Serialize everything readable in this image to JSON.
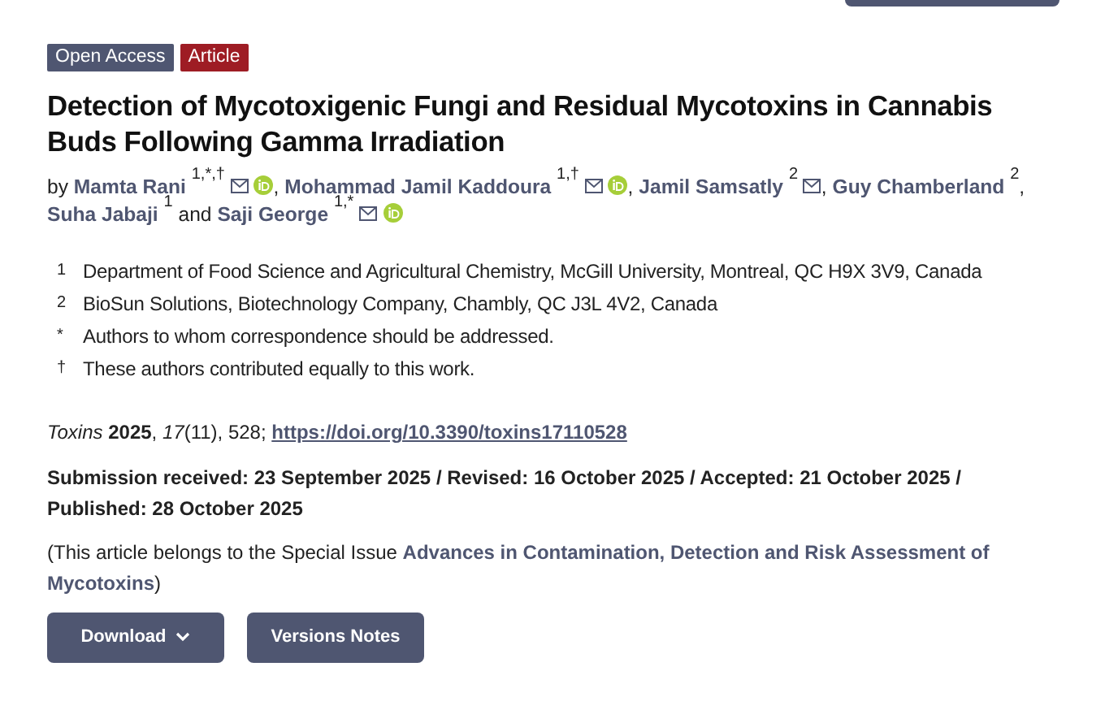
{
  "badges": [
    {
      "label": "Open Access",
      "color": "#4f5671"
    },
    {
      "label": "Article",
      "color": "#9e1c24"
    }
  ],
  "title": "Detection of Mycotoxigenic Fungi and Residual Mycotoxins in Cannabis Buds Following Gamma Irradiation",
  "byline": {
    "prefix": "by",
    "authors": [
      {
        "name": "Mamta Rani",
        "affiliations": "1,*,†",
        "email": true,
        "orcid": true,
        "separator": ","
      },
      {
        "name": "Mohammad Jamil Kaddoura",
        "affiliations": "1,†",
        "email": true,
        "orcid": true,
        "separator": ","
      },
      {
        "name": "Jamil Samsatly",
        "affiliations": "2",
        "email": true,
        "orcid": false,
        "separator": ","
      },
      {
        "name": "Guy Chamberland",
        "affiliations": "2",
        "email": false,
        "orcid": false,
        "separator": ","
      },
      {
        "name": "Suha Jabaji",
        "affiliations": "1",
        "email": false,
        "orcid": false,
        "separator": "and"
      },
      {
        "name": "Saji George",
        "affiliations": "1,*",
        "email": true,
        "orcid": true
      }
    ]
  },
  "notes": [
    {
      "mark": "1",
      "text": "Department of Food Science and Agricultural Chemistry, McGill University, Montreal, QC H9X 3V9, Canada"
    },
    {
      "mark": "2",
      "text": "BioSun Solutions, Biotechnology Company, Chambly, QC J3L 4V2, Canada"
    },
    {
      "mark": "*",
      "text": "Authors to whom correspondence should be addressed."
    },
    {
      "mark": "†",
      "text": "These authors contributed equally to this work."
    }
  ],
  "citation": {
    "text": "*Toxins* **2025**, *17*(11), 528;",
    "doi": "https://doi.org/10.3390/toxins17110528"
  },
  "dates": "Submission received: 23 September 2025 / Revised: 16 October 2025 / Accepted: 21 October 2025 / Published: 28 October 2025",
  "special_issue": {
    "prefix": "(This article belongs to the Special Issue",
    "link_lines": [
      "Advances in Contamination, Detection and Risk Assessment of",
      "Mycotoxins"
    ],
    "suffix": ")"
  },
  "buttons": [
    {
      "label": "Download",
      "dropdown": true
    },
    {
      "label": "Versions Notes",
      "dropdown": false
    }
  ]
}
